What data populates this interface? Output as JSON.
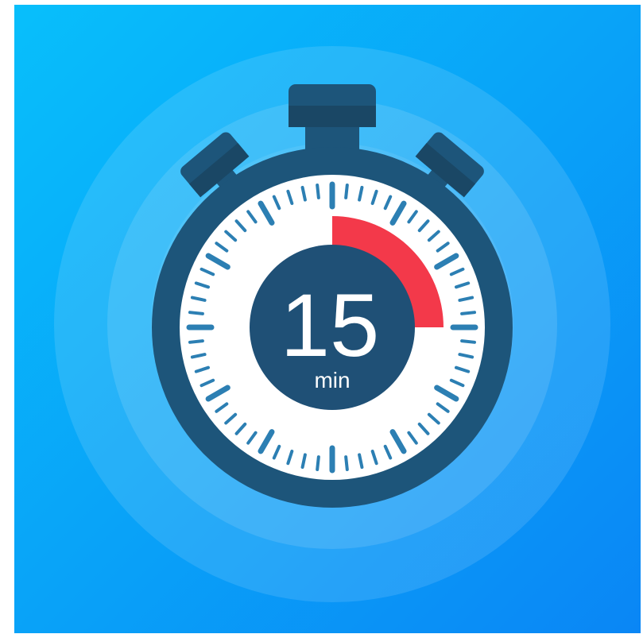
{
  "timer": {
    "value": "15",
    "unit": "min",
    "elapsed_fraction": 0.25
  },
  "dial": {
    "tick_count": 60,
    "major_tick_every": 5
  },
  "colors": {
    "background_start": "#08bffb",
    "background_end": "#0a86f5",
    "case": "#1d557a",
    "case_dark": "#1a4765",
    "face": "#ffffff",
    "tick": "#2c7fb3",
    "hub": "#1f5076",
    "elapsed_sector": "#f3394a",
    "number_text": "#ffffff"
  },
  "icons": {
    "top_crown": "stopwatch-crown",
    "left_button": "stopwatch-side-button",
    "right_button": "stopwatch-side-button"
  }
}
